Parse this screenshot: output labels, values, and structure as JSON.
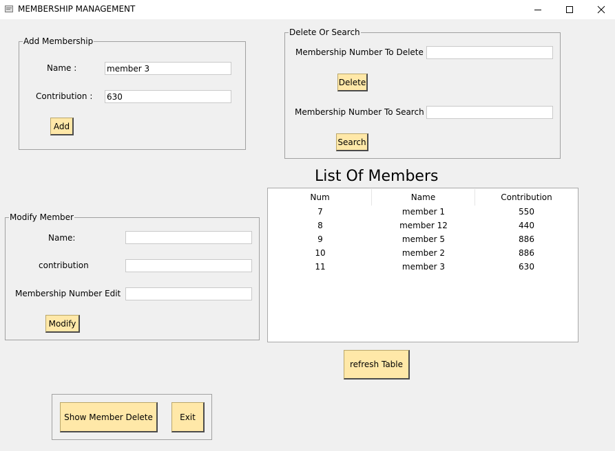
{
  "window": {
    "title": "MEMBERSHIP MANAGEMENT",
    "app_icon": "app-window-icon",
    "controls": [
      "minimize-icon",
      "maximize-icon",
      "close-icon"
    ]
  },
  "add_membership": {
    "legend": "Add Membership",
    "name_label": "Name :",
    "name_value": "member 3",
    "contribution_label": "Contribution :",
    "contribution_value": "630",
    "add_button": "Add"
  },
  "delete_search": {
    "legend": "Delete Or Search",
    "delete_label": "Membership Number To Delete",
    "delete_value": "",
    "delete_button": "Delete",
    "search_label": "Membership Number To Search",
    "search_value": "",
    "search_button": "Search"
  },
  "modify_member": {
    "legend": "Modify Member",
    "name_label": "Name:",
    "name_value": "",
    "contribution_label": "contribution",
    "contribution_value": "",
    "number_label": "Membership Number Edit",
    "number_value": "",
    "modify_button": "Modify"
  },
  "members_list": {
    "heading": "List Of Members",
    "columns": [
      "Num",
      "Name",
      "Contribution"
    ],
    "rows": [
      [
        "7",
        "member 1",
        "550"
      ],
      [
        "8",
        "member 12",
        "440"
      ],
      [
        "9",
        "member 5",
        "886"
      ],
      [
        "10",
        "member 2",
        "886"
      ],
      [
        "11",
        "member 3",
        "630"
      ]
    ],
    "refresh_button": "refresh Table"
  },
  "bottom_actions": {
    "show_deleted_button": "Show Member Delete",
    "exit_button": "Exit"
  },
  "colors": {
    "background": "#f0f0f0",
    "button": "#ffe8a8",
    "titlebar": "#ffffff"
  }
}
